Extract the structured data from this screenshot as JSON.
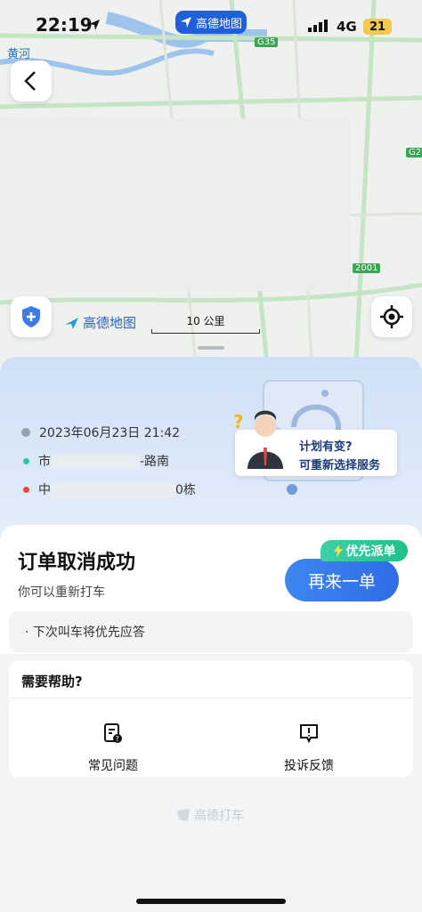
{
  "status_bar": {
    "time": "22:19",
    "network": "4G",
    "battery": "21",
    "app_pill": "高德地图"
  },
  "map": {
    "place_label": "黄河",
    "road_g35": "G35",
    "road_g2": "G2",
    "road_2001": "2001",
    "logo": "高德地图",
    "scale": "10 公里"
  },
  "trip": {
    "datetime": "2023年06月23日 21:42",
    "origin_prefix": "市",
    "origin_suffix": "-路南",
    "dest_prefix": "中",
    "dest_suffix": "0栋"
  },
  "promo": {
    "line1": "计划有变?",
    "line2": "可重新选择服务"
  },
  "order": {
    "title": "订单取消成功",
    "subtitle": "你可以重新打车",
    "badge": "优先派单",
    "again_button": "再来一单",
    "notice": "· 下次叫车将优先应答"
  },
  "help": {
    "title": "需要帮助?",
    "faq": "常见问题",
    "complaint": "投诉反馈"
  },
  "footer": {
    "brand": "高德打车"
  },
  "colors": {
    "accent": "#2f6de6",
    "badge_green": "#1fc08b",
    "origin_dot": "#2bc7a0",
    "dest_dot": "#e5483d"
  }
}
